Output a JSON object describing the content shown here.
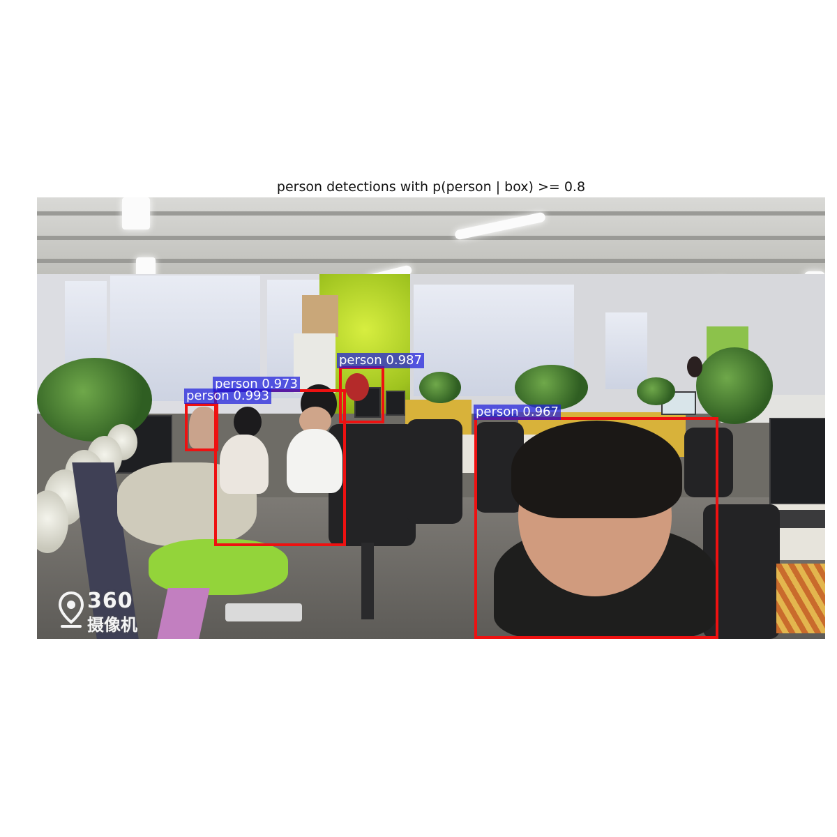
{
  "title": "person detections with p(person | box) >= 0.8",
  "watermark": {
    "brand": "360",
    "subtitle": "摄像机"
  },
  "detections": [
    {
      "class": "person",
      "score": "0.987",
      "label": "person 0.987"
    },
    {
      "class": "person",
      "score": "0.973",
      "label": "person 0.973"
    },
    {
      "class": "person",
      "score": "0.993",
      "label": "person 0.993"
    },
    {
      "class": "person",
      "score": "0.967",
      "label": "person 0.967"
    }
  ],
  "colors": {
    "box": "#ee1111",
    "label_background": "#1e1edc",
    "label_text": "#ffffff"
  }
}
